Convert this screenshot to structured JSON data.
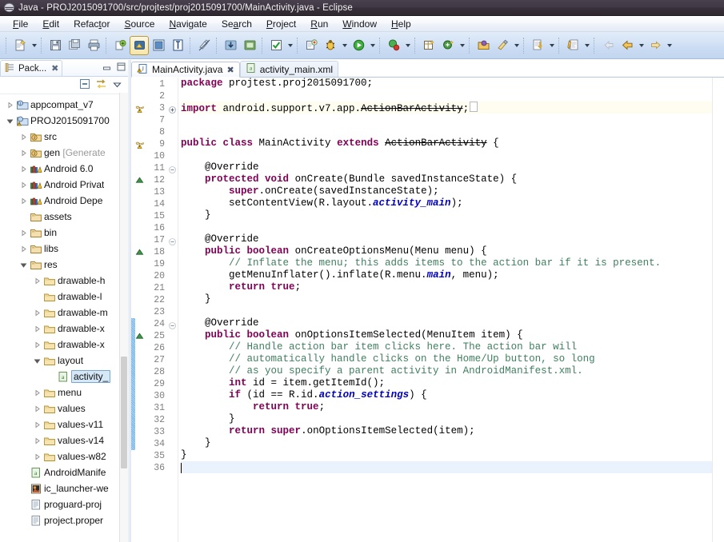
{
  "window": {
    "title": "Java - PROJ2015091700/src/projtest/proj2015091700/MainActivity.java - Eclipse",
    "app_icon": "eclipse-icon"
  },
  "menubar": {
    "items": [
      {
        "label": "File",
        "mnemonic": "F"
      },
      {
        "label": "Edit",
        "mnemonic": "E"
      },
      {
        "label": "Refactor",
        "mnemonic": "t"
      },
      {
        "label": "Source",
        "mnemonic": "S"
      },
      {
        "label": "Navigate",
        "mnemonic": "N"
      },
      {
        "label": "Search",
        "mnemonic": "a"
      },
      {
        "label": "Project",
        "mnemonic": "P"
      },
      {
        "label": "Run",
        "mnemonic": "R"
      },
      {
        "label": "Window",
        "mnemonic": "W"
      },
      {
        "label": "Help",
        "mnemonic": "H"
      }
    ]
  },
  "toolbar": {
    "groups": [
      {
        "buttons": [
          {
            "icon": "new-wizard-icon",
            "dropdown": true
          },
          {
            "icon": "save-icon",
            "dropdown": false
          },
          {
            "icon": "save-all-icon",
            "dropdown": false
          },
          {
            "icon": "print-icon",
            "dropdown": false
          }
        ]
      },
      {
        "buttons": [
          {
            "icon": "new-android-project-icon",
            "dropdown": false
          },
          {
            "icon": "android-sdk-manager-icon",
            "dropdown": false,
            "active": true
          },
          {
            "icon": "android-virtual-device-manager-icon",
            "dropdown": false
          },
          {
            "icon": "lint-warnings-icon",
            "dropdown": false
          }
        ]
      },
      {
        "buttons": [
          {
            "icon": "toggle-mark-occurrences-icon",
            "dropdown": false
          }
        ]
      },
      {
        "buttons": [
          {
            "icon": "import-icon",
            "dropdown": false
          },
          {
            "icon": "export-icon",
            "dropdown": false
          }
        ]
      },
      {
        "buttons": [
          {
            "icon": "check-validate-icon",
            "dropdown": true
          }
        ]
      },
      {
        "buttons": [
          {
            "icon": "new-java-project-icon",
            "dropdown": false
          },
          {
            "icon": "debug-icon",
            "dropdown": true
          },
          {
            "icon": "run-icon",
            "dropdown": true
          }
        ]
      },
      {
        "buttons": [
          {
            "icon": "external-tools-icon",
            "dropdown": true
          }
        ]
      },
      {
        "buttons": [
          {
            "icon": "new-package-icon",
            "dropdown": false
          },
          {
            "icon": "new-class-icon",
            "dropdown": true
          }
        ]
      },
      {
        "buttons": [
          {
            "icon": "open-type-icon",
            "dropdown": false
          },
          {
            "icon": "search-icon",
            "dropdown": true
          }
        ]
      },
      {
        "buttons": [
          {
            "icon": "next-annotation-icon",
            "dropdown": true
          }
        ]
      },
      {
        "buttons": [
          {
            "icon": "last-edit-location-icon",
            "dropdown": true
          }
        ]
      },
      {
        "buttons": [
          {
            "icon": "back-disabled-icon",
            "dropdown": false
          },
          {
            "icon": "back-icon",
            "dropdown": true
          },
          {
            "icon": "forward-icon",
            "dropdown": true
          }
        ]
      }
    ]
  },
  "package_explorer": {
    "tab_label": "Pack...",
    "tab_icon": "package-explorer-icon",
    "close_icon": "close-icon",
    "minimize_icon": "minimize-icon",
    "maximize_icon": "maximize-icon",
    "tools": [
      {
        "icon": "collapse-all-icon"
      },
      {
        "icon": "link-with-editor-icon"
      },
      {
        "icon": "view-menu-icon"
      }
    ],
    "tree": [
      {
        "label": "appcompat_v7",
        "icon": "java-project-icon",
        "indent": 0,
        "twisty": "closed",
        "selected": false
      },
      {
        "label": "PROJ2015091700",
        "icon": "java-project-warning-icon",
        "indent": 0,
        "twisty": "open",
        "selected": false
      },
      {
        "label": "src",
        "icon": "source-folder-icon",
        "indent": 1,
        "twisty": "closed",
        "selected": false
      },
      {
        "label": "gen [Generate",
        "icon": "source-folder-icon",
        "indent": 1,
        "twisty": "closed",
        "selected": false,
        "dim_from": 4
      },
      {
        "label": "Android 6.0",
        "icon": "library-icon",
        "indent": 1,
        "twisty": "closed",
        "selected": false
      },
      {
        "label": "Android Privat",
        "icon": "library-icon",
        "indent": 1,
        "twisty": "closed",
        "selected": false
      },
      {
        "label": "Android Depe",
        "icon": "library-icon",
        "indent": 1,
        "twisty": "closed",
        "selected": false
      },
      {
        "label": "assets",
        "icon": "folder-res-icon",
        "indent": 1,
        "twisty": "none",
        "selected": false
      },
      {
        "label": "bin",
        "icon": "folder-res-icon",
        "indent": 1,
        "twisty": "closed",
        "selected": false
      },
      {
        "label": "libs",
        "icon": "folder-res-icon",
        "indent": 1,
        "twisty": "closed",
        "selected": false
      },
      {
        "label": "res",
        "icon": "folder-res-icon",
        "indent": 1,
        "twisty": "open",
        "selected": false
      },
      {
        "label": "drawable-h",
        "icon": "folder-icon",
        "indent": 2,
        "twisty": "closed",
        "selected": false
      },
      {
        "label": "drawable-l",
        "icon": "folder-icon",
        "indent": 2,
        "twisty": "none",
        "selected": false
      },
      {
        "label": "drawable-m",
        "icon": "folder-icon",
        "indent": 2,
        "twisty": "closed",
        "selected": false
      },
      {
        "label": "drawable-x",
        "icon": "folder-icon",
        "indent": 2,
        "twisty": "closed",
        "selected": false
      },
      {
        "label": "drawable-x",
        "icon": "folder-icon",
        "indent": 2,
        "twisty": "closed",
        "selected": false
      },
      {
        "label": "layout",
        "icon": "folder-icon",
        "indent": 2,
        "twisty": "open",
        "selected": false
      },
      {
        "label": "activity_",
        "icon": "xml-file-icon",
        "indent": 3,
        "twisty": "none",
        "selected": true
      },
      {
        "label": "menu",
        "icon": "folder-icon",
        "indent": 2,
        "twisty": "closed",
        "selected": false
      },
      {
        "label": "values",
        "icon": "folder-icon",
        "indent": 2,
        "twisty": "closed",
        "selected": false
      },
      {
        "label": "values-v11",
        "icon": "folder-icon",
        "indent": 2,
        "twisty": "closed",
        "selected": false
      },
      {
        "label": "values-v14",
        "icon": "folder-icon",
        "indent": 2,
        "twisty": "closed",
        "selected": false
      },
      {
        "label": "values-w82",
        "icon": "folder-icon",
        "indent": 2,
        "twisty": "closed",
        "selected": false
      },
      {
        "label": "AndroidManife",
        "icon": "xml-file-icon",
        "indent": 1,
        "twisty": "none",
        "selected": false
      },
      {
        "label": "ic_launcher-we",
        "icon": "image-file-icon",
        "indent": 1,
        "twisty": "none",
        "selected": false
      },
      {
        "label": "proguard-proj",
        "icon": "text-file-icon",
        "indent": 1,
        "twisty": "none",
        "selected": false
      },
      {
        "label": "project.proper",
        "icon": "text-file-icon",
        "indent": 1,
        "twisty": "none",
        "selected": false
      }
    ]
  },
  "editor": {
    "tabs": [
      {
        "label": "MainActivity.java",
        "icon": "java-file-warning-icon",
        "selected": true,
        "closable": true
      },
      {
        "label": "activity_main.xml",
        "icon": "xml-file-icon",
        "selected": false,
        "closable": false
      }
    ],
    "caret_line": 36,
    "lines": [
      {
        "n": 1,
        "fold": "none",
        "marker": "none",
        "change": false
      },
      {
        "n": 2,
        "fold": "none",
        "marker": "none",
        "change": false
      },
      {
        "n": 3,
        "fold": "plus",
        "marker": "warning",
        "change": false
      },
      {
        "n": 7,
        "fold": "none",
        "marker": "none",
        "change": false
      },
      {
        "n": 8,
        "fold": "none",
        "marker": "none",
        "change": false
      },
      {
        "n": 9,
        "fold": "none",
        "marker": "warning",
        "change": false
      },
      {
        "n": 10,
        "fold": "none",
        "marker": "none",
        "change": false
      },
      {
        "n": 11,
        "fold": "minus",
        "marker": "none",
        "change": false
      },
      {
        "n": 12,
        "fold": "none",
        "marker": "override",
        "change": false
      },
      {
        "n": 13,
        "fold": "none",
        "marker": "none",
        "change": false
      },
      {
        "n": 14,
        "fold": "none",
        "marker": "none",
        "change": false
      },
      {
        "n": 15,
        "fold": "none",
        "marker": "none",
        "change": false
      },
      {
        "n": 16,
        "fold": "none",
        "marker": "none",
        "change": false
      },
      {
        "n": 17,
        "fold": "minus",
        "marker": "none",
        "change": false
      },
      {
        "n": 18,
        "fold": "none",
        "marker": "override",
        "change": false
      },
      {
        "n": 19,
        "fold": "none",
        "marker": "none",
        "change": false
      },
      {
        "n": 20,
        "fold": "none",
        "marker": "none",
        "change": false
      },
      {
        "n": 21,
        "fold": "none",
        "marker": "none",
        "change": false
      },
      {
        "n": 22,
        "fold": "none",
        "marker": "none",
        "change": false
      },
      {
        "n": 23,
        "fold": "none",
        "marker": "none",
        "change": false
      },
      {
        "n": 24,
        "fold": "minus",
        "marker": "none",
        "change": true
      },
      {
        "n": 25,
        "fold": "none",
        "marker": "override",
        "change": true
      },
      {
        "n": 26,
        "fold": "none",
        "marker": "none",
        "change": true
      },
      {
        "n": 27,
        "fold": "none",
        "marker": "none",
        "change": true
      },
      {
        "n": 28,
        "fold": "none",
        "marker": "none",
        "change": true
      },
      {
        "n": 29,
        "fold": "none",
        "marker": "none",
        "change": true
      },
      {
        "n": 30,
        "fold": "none",
        "marker": "none",
        "change": true
      },
      {
        "n": 31,
        "fold": "none",
        "marker": "none",
        "change": true
      },
      {
        "n": 32,
        "fold": "none",
        "marker": "none",
        "change": true
      },
      {
        "n": 33,
        "fold": "none",
        "marker": "none",
        "change": true
      },
      {
        "n": 34,
        "fold": "none",
        "marker": "none",
        "change": true
      },
      {
        "n": 35,
        "fold": "none",
        "marker": "none",
        "change": false
      },
      {
        "n": 36,
        "fold": "none",
        "marker": "none",
        "change": false
      }
    ],
    "source_text": [
      "package projtest.proj2015091700;",
      "",
      "import android.support.v7.app.ActionBarActivity;",
      "",
      "",
      "public class MainActivity extends ActionBarActivity {",
      "",
      "    @Override",
      "    protected void onCreate(Bundle savedInstanceState) {",
      "        super.onCreate(savedInstanceState);",
      "        setContentView(R.layout.activity_main);",
      "    }",
      "",
      "    @Override",
      "    public boolean onCreateOptionsMenu(Menu menu) {",
      "        // Inflate the menu; this adds items to the action bar if it is present.",
      "        getMenuInflater().inflate(R.menu.main, menu);",
      "        return true;",
      "    }",
      "",
      "    @Override",
      "    public boolean onOptionsItemSelected(MenuItem item) {",
      "        // Handle action bar item clicks here. The action bar will",
      "        // automatically handle clicks on the Home/Up button, so long",
      "        // as you specify a parent activity in AndroidManifest.xml.",
      "        int id = item.getItemId();",
      "        if (id == R.id.action_settings) {",
      "            return true;",
      "        }",
      "        return super.onOptionsItemSelected(item);",
      "    }",
      "}",
      ""
    ]
  },
  "colors": {
    "titlebar_bg": "#3b3340",
    "menubar_bg": "#eef2f9",
    "toolbar_bg": "#cbdcf3",
    "keyword": "#7f0055",
    "comment": "#3f7f5f",
    "field": "#0000c0",
    "selection": "#d5e8f7",
    "current_line": "#eaf2fd",
    "changebar": "#8cc4ea"
  }
}
